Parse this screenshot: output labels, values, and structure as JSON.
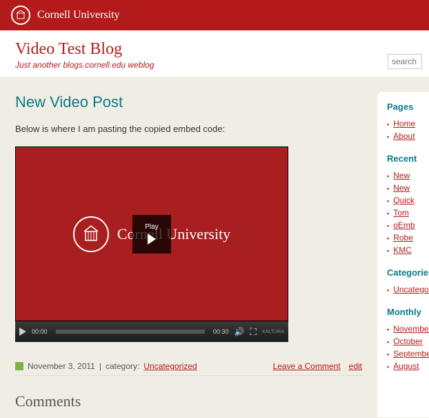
{
  "university": "Cornell University",
  "blog": {
    "title": "Video Test Blog",
    "tagline": "Just another blogs.cornell.edu weblog",
    "search_placeholder": "search"
  },
  "post": {
    "title": "New Video Post",
    "body": "Below is where I am pasting the copied embed code:",
    "date": "November 3, 2011",
    "category_label": "category:",
    "category": "Uncategorized",
    "leave_comment": "Leave a Comment",
    "edit": "edit",
    "comments_heading": "Comments"
  },
  "video": {
    "brand": "Cornell University",
    "play_label": "Play",
    "time_current": "00:00",
    "time_total": "00:30",
    "provider": "KALTURA"
  },
  "sidebar": {
    "pages": {
      "title": "Pages",
      "items": [
        "Home",
        "About"
      ]
    },
    "recent": {
      "title": "Recent",
      "items": [
        "New",
        "New",
        "Quick",
        "Tom",
        "oEmb",
        "Robe",
        "KMC"
      ]
    },
    "categories": {
      "title": "Categories",
      "items": [
        "Uncategorized"
      ]
    },
    "monthly": {
      "title": "Monthly",
      "items": [
        "November",
        "October",
        "September",
        "August"
      ]
    }
  }
}
